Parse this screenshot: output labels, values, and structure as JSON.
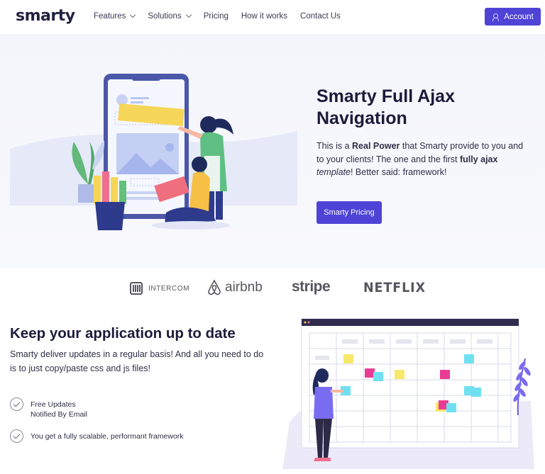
{
  "nav": {
    "logo": "smarty",
    "items": [
      {
        "label": "Features",
        "dropdown": true
      },
      {
        "label": "Solutions",
        "dropdown": true
      },
      {
        "label": "Pricing",
        "dropdown": false
      },
      {
        "label": "How it works",
        "dropdown": false
      },
      {
        "label": "Contact Us",
        "dropdown": false
      }
    ],
    "account_label": "Account"
  },
  "hero": {
    "title": "Smarty Full Ajax Navigation",
    "text_pre": "This is a ",
    "text_bold1": "Real Power",
    "text_mid": " that Smarty provide to you and to your clients! The one and the first ",
    "text_bold2": "fully ajax",
    "text_space": " ",
    "text_em": "template",
    "text_post": "! Better said: framework!",
    "button_label": "Smarty Pricing"
  },
  "brands": {
    "intercom": "INTERCOM",
    "airbnb": "airbnb",
    "stripe": "stripe",
    "netflix": "NETFLIX"
  },
  "section2": {
    "title": "Keep your application up to date",
    "text": "Smarty deliver updates in a regular basis! And all you need to do is to just copy/paste css and js files!",
    "features": [
      "Free Updates",
      "Notified By Email",
      "You get a fully scalable, performant framework"
    ]
  },
  "colors": {
    "accent": "#4e43d6",
    "text_dark": "#1b1b3a",
    "hero_bg": "#f4f5fb"
  }
}
